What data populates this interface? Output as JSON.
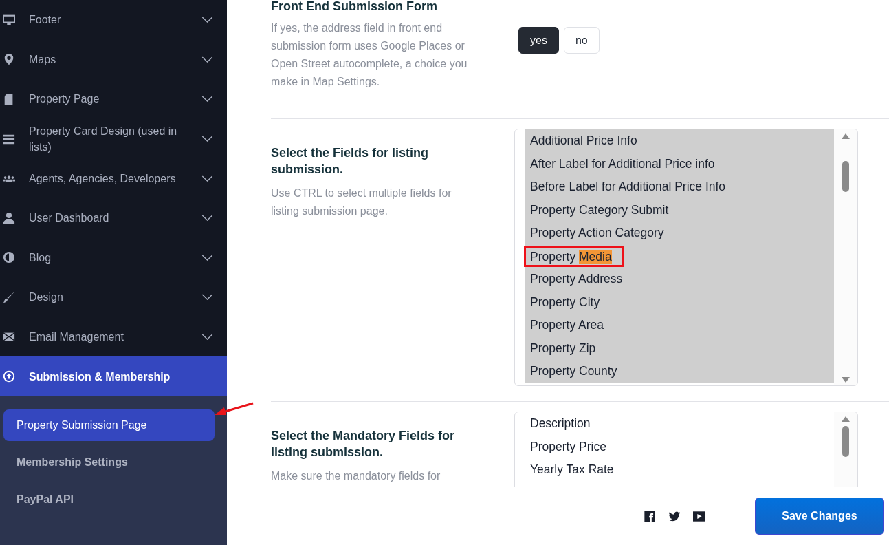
{
  "sidebar": {
    "items": [
      {
        "label": "Footer",
        "expanded": false,
        "selected": false
      },
      {
        "label": "Maps",
        "expanded": false,
        "selected": false
      },
      {
        "label": "Property Page",
        "expanded": false,
        "selected": false
      },
      {
        "label": "Property Card Design (used in lists)",
        "expanded": false,
        "selected": false
      },
      {
        "label": "Agents, Agencies, Developers",
        "expanded": false,
        "selected": false
      },
      {
        "label": "User Dashboard",
        "expanded": false,
        "selected": false
      },
      {
        "label": "Blog",
        "expanded": false,
        "selected": false
      },
      {
        "label": "Design",
        "expanded": false,
        "selected": false
      },
      {
        "label": "Email Management",
        "expanded": false,
        "selected": false
      },
      {
        "label": "Submission & Membership",
        "expanded": true,
        "selected": true,
        "children": [
          {
            "label": "Property Submission Page",
            "selected": true,
            "annotated": true
          },
          {
            "label": "Membership Settings",
            "selected": false,
            "annotated": false
          },
          {
            "label": "PayPal API",
            "selected": false,
            "annotated": false
          }
        ]
      }
    ]
  },
  "sections": [
    {
      "kind": "toggle",
      "title": "Front End Submission Form",
      "description": "If yes, the address field in front end submission form uses Google Places or Open Street autocomplete, a choice you make in Map Settings.",
      "options": [
        {
          "label": "yes",
          "selected": true
        },
        {
          "label": "no",
          "selected": false
        }
      ]
    },
    {
      "kind": "multiselect",
      "title": "Select the Fields for listing submission.",
      "description": "Use CTRL to select multiple fields for listing submission page.",
      "options": [
        {
          "label": "Additional Price Info",
          "selected": true
        },
        {
          "label": "After Label for Additional Price info",
          "selected": true
        },
        {
          "label": "Before Label for Additional Price Info",
          "selected": true
        },
        {
          "label": "Property Category Submit",
          "selected": true
        },
        {
          "label": "Property Action Category",
          "selected": true
        },
        {
          "label": "Property",
          "highlight": "Media",
          "selected": true,
          "annotated": true
        },
        {
          "label": "Property Address",
          "selected": true
        },
        {
          "label": "Property City",
          "selected": true
        },
        {
          "label": "Property Area",
          "selected": true
        },
        {
          "label": "Property Zip",
          "selected": true
        },
        {
          "label": "Property County",
          "selected": true
        }
      ]
    },
    {
      "kind": "multiselect",
      "title": "Select the Mandatory Fields for listing submission.",
      "description": "Make sure the mandatory fields for",
      "options": [
        {
          "label": "Description",
          "selected": false
        },
        {
          "label": "Property Price",
          "selected": false
        },
        {
          "label": "Yearly Tax Rate",
          "selected": false
        }
      ]
    }
  ],
  "footer": {
    "save_button": "Save Changes"
  }
}
